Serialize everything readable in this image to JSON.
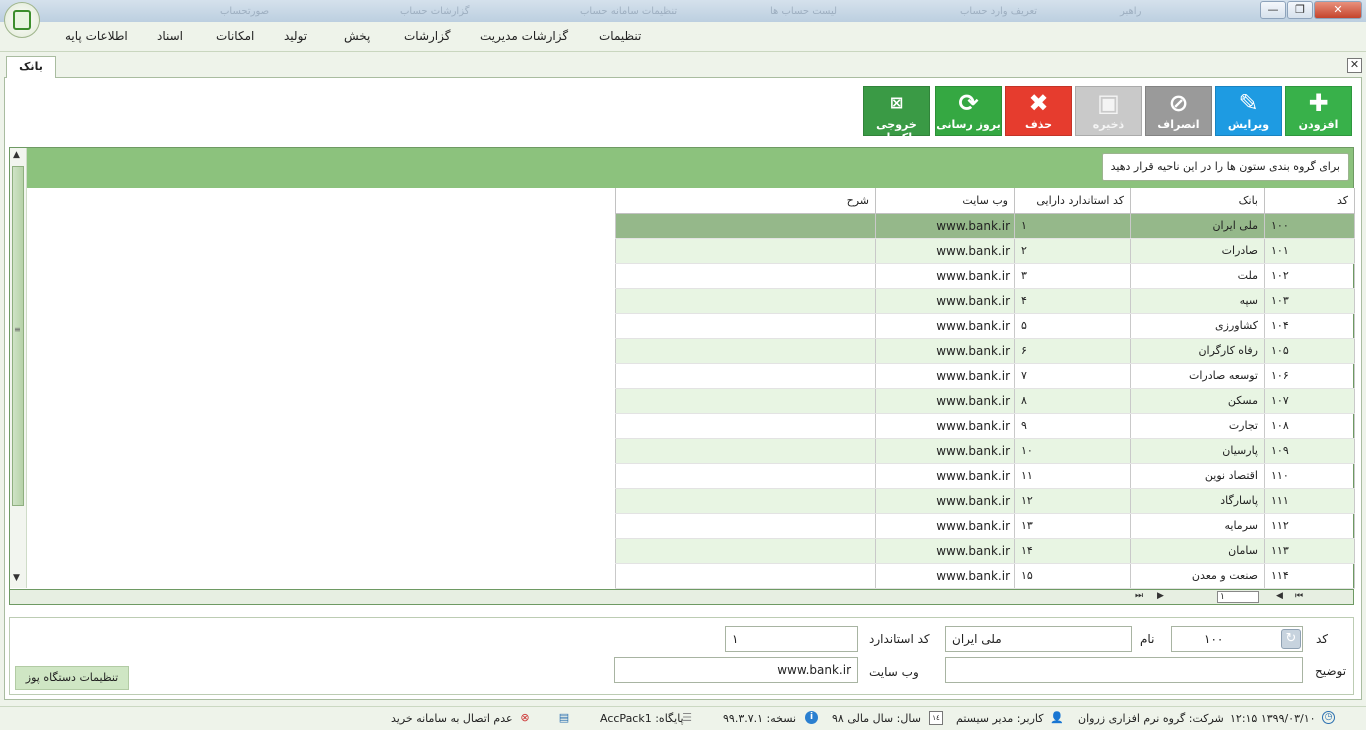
{
  "window": {
    "background_tabs": [
      "راهبر",
      "تعریف وارد حساب",
      "لیست حساب ها",
      "تنظیمات سامانه حساب",
      "گزارشات حساب",
      "صورتحساب"
    ],
    "controls": {
      "minimize": "—",
      "maximize": "❐",
      "close": "✕"
    }
  },
  "menu": [
    "تنظیمات",
    "گزارشات مدیریت",
    "گزارشات",
    "پخش",
    "تولید",
    "امکانات",
    "اسناد",
    "اطلاعات پایه"
  ],
  "tab": {
    "title": "بانک"
  },
  "toolbar": {
    "add": "افزودن",
    "edit": "ویرایش",
    "cancel": "انصراف",
    "save": "ذخیره",
    "delete": "حذف",
    "refresh": "بروز رسانی",
    "excel": "خروجی اکسل"
  },
  "colors": {
    "add": "#38b14a",
    "edit": "#1e9be2",
    "cancel": "#9a9a9a",
    "save": "#c9c9c9",
    "delete": "#e63c2e",
    "refresh": "#35a842",
    "excel": "#3a9a45",
    "selected_row": "#95b88a",
    "alt_row": "#e8f5e3",
    "group_band": "#8cc27d"
  },
  "grid": {
    "group_hint": "برای گروه بندی ستون ها را در این ناحیه قرار دهید",
    "columns": {
      "code": "کد",
      "bank": "بانک",
      "asset_code": "کد استاندارد دارایی",
      "website": "وب سایت",
      "description": "شرح"
    },
    "rows": [
      {
        "code": "۱۰۰",
        "bank": "ملی ایران",
        "asset": "۱",
        "web": "www.bank.ir",
        "desc": ""
      },
      {
        "code": "۱۰۱",
        "bank": "صادرات",
        "asset": "۲",
        "web": "www.bank.ir",
        "desc": ""
      },
      {
        "code": "۱۰۲",
        "bank": "ملت",
        "asset": "۳",
        "web": "www.bank.ir",
        "desc": ""
      },
      {
        "code": "۱۰۳",
        "bank": "سپه",
        "asset": "۴",
        "web": "www.bank.ir",
        "desc": ""
      },
      {
        "code": "۱۰۴",
        "bank": "کشاورزی",
        "asset": "۵",
        "web": "www.bank.ir",
        "desc": ""
      },
      {
        "code": "۱۰۵",
        "bank": "رفاه کارگران",
        "asset": "۶",
        "web": "www.bank.ir",
        "desc": ""
      },
      {
        "code": "۱۰۶",
        "bank": "توسعه صادرات",
        "asset": "۷",
        "web": "www.bank.ir",
        "desc": ""
      },
      {
        "code": "۱۰۷",
        "bank": "مسکن",
        "asset": "۸",
        "web": "www.bank.ir",
        "desc": ""
      },
      {
        "code": "۱۰۸",
        "bank": "تجارت",
        "asset": "۹",
        "web": "www.bank.ir",
        "desc": ""
      },
      {
        "code": "۱۰۹",
        "bank": "پارسیان",
        "asset": "۱۰",
        "web": "www.bank.ir",
        "desc": ""
      },
      {
        "code": "۱۱۰",
        "bank": "اقتصاد نوین",
        "asset": "۱۱",
        "web": "www.bank.ir",
        "desc": ""
      },
      {
        "code": "۱۱۱",
        "bank": "پاسارگاد",
        "asset": "۱۲",
        "web": "www.bank.ir",
        "desc": ""
      },
      {
        "code": "۱۱۲",
        "bank": "سرمایه",
        "asset": "۱۳",
        "web": "www.bank.ir",
        "desc": ""
      },
      {
        "code": "۱۱۳",
        "bank": "سامان",
        "asset": "۱۴",
        "web": "www.bank.ir",
        "desc": ""
      },
      {
        "code": "۱۱۴",
        "bank": "صنعت و معدن",
        "asset": "۱۵",
        "web": "www.bank.ir",
        "desc": ""
      }
    ],
    "selected_index": 0,
    "pager": {
      "first": "⏮",
      "prev": "◀",
      "page": "۱",
      "next": "▶",
      "last": "⏭"
    }
  },
  "form": {
    "code_label": "کد",
    "code_value": "۱۰۰",
    "name_label": "نام",
    "name_value": "ملی ایران",
    "std_code_label": "کد استاندارد",
    "std_code_value": "۱",
    "desc_label": "توضیح",
    "desc_value": "",
    "website_label": "وب سایت",
    "website_value": "www.bank.ir",
    "pos_settings": "تنظیمات دستگاه پوز"
  },
  "status": {
    "datetime": "۱۳۹۹/۰۳/۱۰  ۱۲:۱۵",
    "company": "شرکت: گروه نرم افزاری زروان",
    "user": "کاربر: مدیر سیستم",
    "fiscal_year": "سال: سال مالی ۹۸",
    "version": "نسخه: ۹۹.۳.۷.۱",
    "database": "پایگاه: AccPack1",
    "connection": "عدم اتصال به سامانه خرید"
  }
}
